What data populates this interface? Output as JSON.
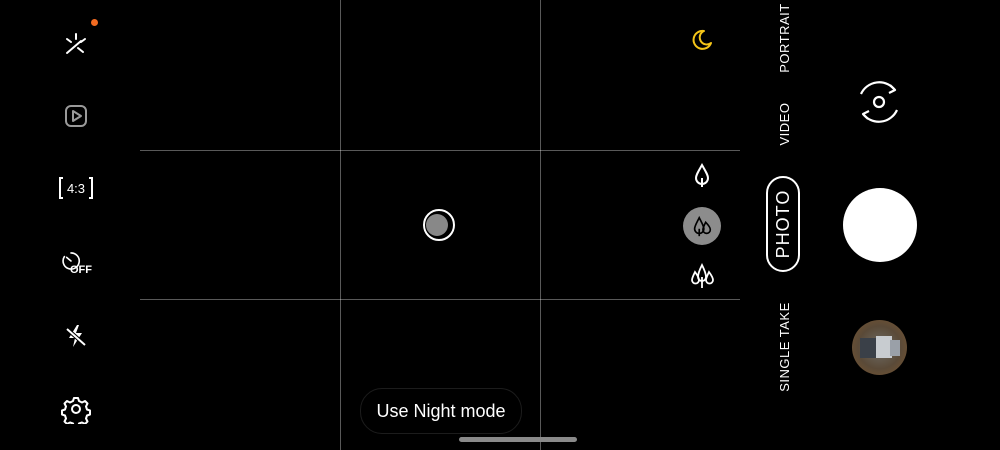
{
  "modes": {
    "portrait": "PORTRAIT",
    "video": "VIDEO",
    "photo": "PHOTO",
    "single_take": "SINGLE TAKE"
  },
  "left_toolbar": {
    "aspect_ratio": "4:3",
    "timer": "OFF"
  },
  "night_mode_button": "Use Night mode",
  "colors": {
    "background": "#000000",
    "night_icon": "#f5c518",
    "notification_dot": "#f26b21",
    "selected_zoom_bg": "#8c8c8c"
  },
  "icons": {
    "effects": "sparkle-icon",
    "motion_photo": "motion-photo-icon",
    "timer": "timer-icon",
    "flash": "flash-off-icon",
    "settings": "gear-icon",
    "night": "moon-icon",
    "switch_camera": "camera-switch-icon",
    "zoom_tele": "single-leaf-icon",
    "zoom_wide": "double-leaf-icon",
    "zoom_ultrawide": "triple-tree-icon"
  }
}
